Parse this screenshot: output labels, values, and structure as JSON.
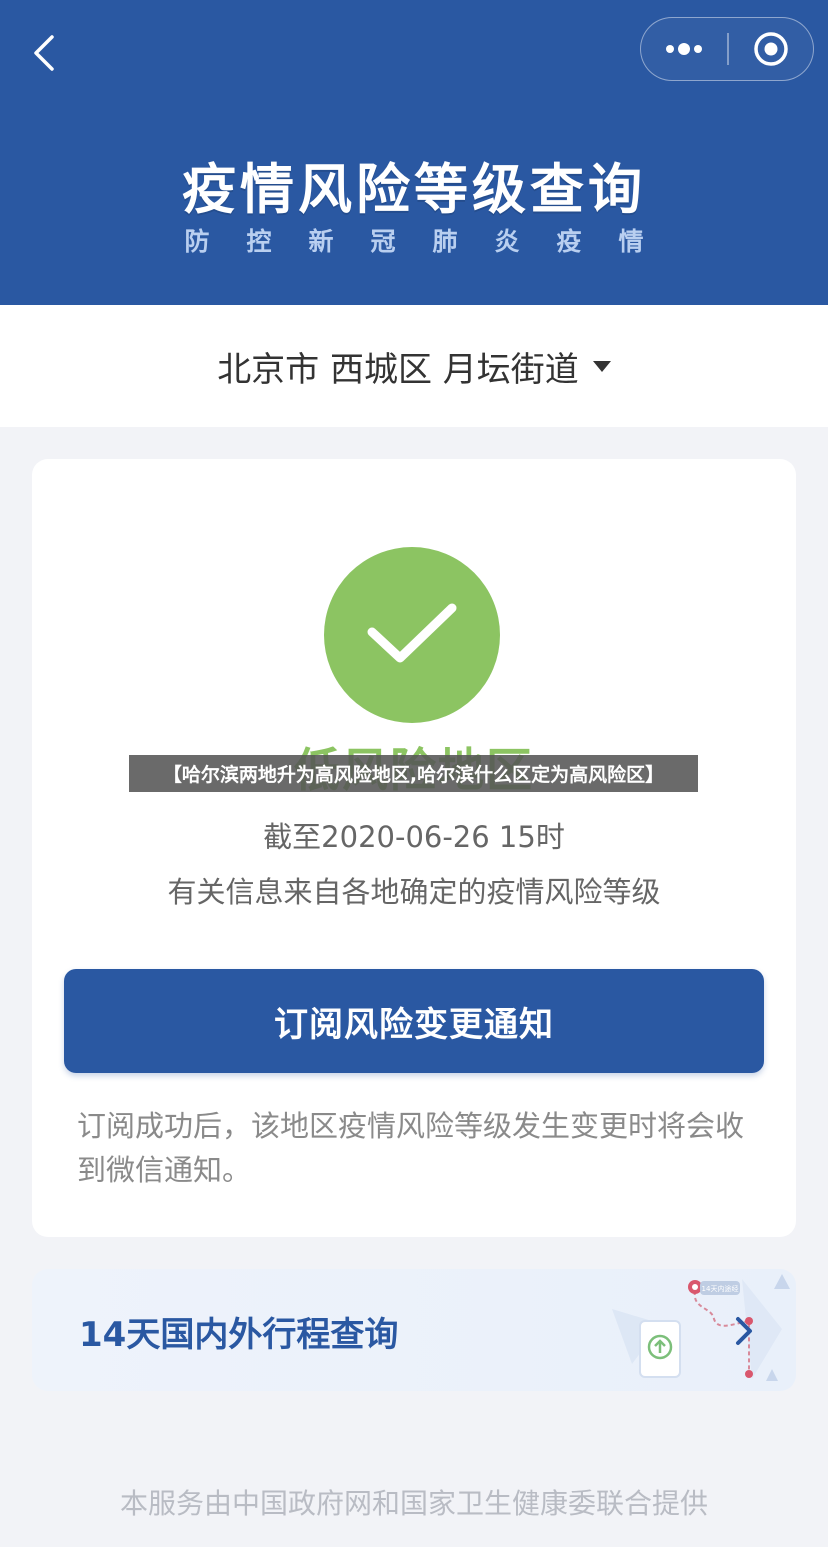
{
  "header": {
    "title": "疫情风险等级查询",
    "subtitle": "防控新冠肺炎疫情"
  },
  "location": {
    "label": "北京市 西城区 月坛街道"
  },
  "result": {
    "risk_level": "低风险地区",
    "updated_line": "截至2020-06-26 15时",
    "source_line": "有关信息来自各地确定的疫情风险等级",
    "subscribe_button": "订阅风险变更通知",
    "subscribe_note": "订阅成功后，该地区疫情风险等级发生变更时将会收到微信通知。",
    "status_color": "#8cc462"
  },
  "itinerary": {
    "title": "14天国内外行程查询",
    "illustration_tag": "14天内途经"
  },
  "footer": {
    "text": "本服务由中国政府网和国家卫生健康委联合提供"
  },
  "overlay": {
    "text": "【哈尔滨两地升为高风险地区,哈尔滨什么区定为高风险区】"
  },
  "colors": {
    "primary": "#2a58a2",
    "success": "#8cc462",
    "background": "#f2f3f7"
  },
  "icons": [
    "back-arrow-icon",
    "more-dots-icon",
    "close-target-icon",
    "caret-down-icon",
    "checkmark-icon",
    "chevron-right-icon"
  ]
}
